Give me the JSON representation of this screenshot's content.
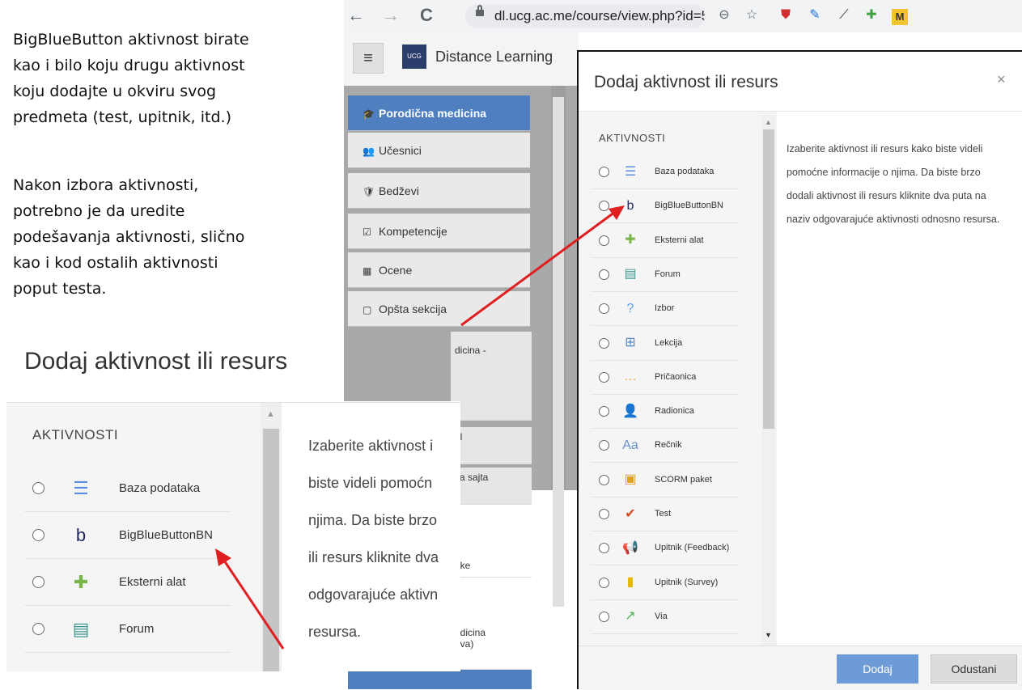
{
  "instructions": {
    "p1": [
      "BigBlueButton aktivnost birate",
      "kao i bilo koju drugu aktivnost",
      "koju dodajte u okviru svog",
      "predmeta (test, upitnik, itd.)"
    ],
    "p2": [
      "Nakon izbora aktivnosti,",
      "potrebno je da uredite",
      "podešavanja aktivnosti, slično",
      "kao i kod ostalih aktivnosti",
      "poput testa."
    ]
  },
  "browser": {
    "url": "dl.ucg.ac.me/course/view.php?id=554...",
    "back_icon": "←",
    "forward_icon": "→",
    "reload_icon": "C"
  },
  "moodle": {
    "site_name": "Distance Learning",
    "logo_text": "UCG",
    "nav": [
      {
        "label": "Porodična medicina",
        "icon": "🎓",
        "active": true
      },
      {
        "label": "Učesnici",
        "icon": "👥"
      },
      {
        "label": "Bedževi",
        "icon": "🛡"
      },
      {
        "label": "Kompetencije",
        "icon": "☑"
      },
      {
        "label": "Ocene",
        "icon": "▦"
      },
      {
        "label": "Opšta sekcija",
        "icon": "▢"
      }
    ],
    "lower_fragments": [
      "dicina -",
      "el",
      "ca sajta",
      "eke",
      "edicina\nava)"
    ]
  },
  "modal": {
    "title": "Dodaj aktivnost ili resurs",
    "close": "×",
    "section": "AKTIVNOSTI",
    "options": [
      {
        "label": "Baza podataka",
        "icon": "☰",
        "color": "#5b8ee6"
      },
      {
        "label": "BigBlueButtonBN",
        "icon": "b",
        "color": "#1f2a5c"
      },
      {
        "label": "Eksterni alat",
        "icon": "✚",
        "color": "#7ab648"
      },
      {
        "label": "Forum",
        "icon": "▤",
        "color": "#3f9a8f"
      },
      {
        "label": "Izbor",
        "icon": "?",
        "color": "#5aa2e6"
      },
      {
        "label": "Lekcija",
        "icon": "⊞",
        "color": "#4f86c6"
      },
      {
        "label": "Pričaonica",
        "icon": "…",
        "color": "#f0a030"
      },
      {
        "label": "Radionica",
        "icon": "👤",
        "color": "#d98a2b"
      },
      {
        "label": "Rečnik",
        "icon": "Aa",
        "color": "#6a8fc7"
      },
      {
        "label": "SCORM paket",
        "icon": "▣",
        "color": "#e0a020"
      },
      {
        "label": "Test",
        "icon": "✔",
        "color": "#d44a1e"
      },
      {
        "label": "Upitnik (Feedback)",
        "icon": "📢",
        "color": "#c0392b"
      },
      {
        "label": "Upitnik (Survey)",
        "icon": "▮",
        "color": "#e6b800"
      },
      {
        "label": "Via",
        "icon": "↗",
        "color": "#4caf50"
      }
    ],
    "help_text": "Izaberite aktivnost ili resurs kako biste videli pomoćne informacije o njima. Da biste brzo dodali aktivnost ili resurs kliknite dva puta na naziv odgovarajuće aktivnosti odnosno resursa.",
    "add_button": "Dodaj",
    "cancel_button": "Odustani"
  },
  "zoom": {
    "title": "Dodaj aktivnost ili resurs",
    "section": "AKTIVNOSTI",
    "options": [
      {
        "label": "Baza podataka",
        "icon": "☰",
        "color": "#5b8ee6"
      },
      {
        "label": "BigBlueButtonBN",
        "icon": "b",
        "color": "#1f2a5c"
      },
      {
        "label": "Eksterni alat",
        "icon": "✚",
        "color": "#7ab648"
      },
      {
        "label": "Forum",
        "icon": "▤",
        "color": "#3f9a8f"
      }
    ],
    "help_lines": [
      "Izaberite aktivnost i",
      "biste videli pomoćn",
      "njima. Da biste brzo",
      "ili resurs kliknite dva",
      "odgovarajuće aktivn",
      "resursa."
    ]
  },
  "colors": {
    "arrow": "#e02020",
    "accent": "#4f7fbf"
  }
}
